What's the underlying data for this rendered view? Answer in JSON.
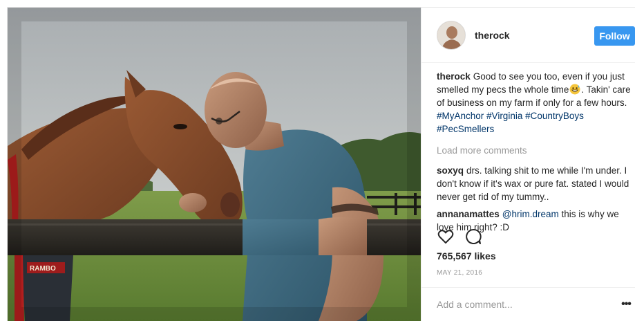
{
  "post": {
    "photo_alt": "Man and horse at fence",
    "blanket_brand": "RAMBO"
  },
  "header": {
    "username": "therock",
    "follow_label": "Follow"
  },
  "caption": {
    "user": "therock",
    "text_before_emoji": "Good to see you too, even if you just smelled my pecs the whole time",
    "emoji": "grinning-face-with-sweat-emoji",
    "text_after_emoji": ". Takin' care of business on my farm if only for a few hours. ",
    "hashtags": [
      "#MyAnchor",
      "#Virginia",
      "#CountryBoys",
      "#PecSmellers"
    ]
  },
  "load_more_label": "Load more comments",
  "comments": [
    {
      "user": "soxyq",
      "text": "drs. talking shit to me while I'm under. I don't know if it's wax or pure fat. stated I would never get rid of my tummy.."
    },
    {
      "user": "annanamattes",
      "mention": "@hrim.dream",
      "text": " this is why we love him right? :D"
    }
  ],
  "actions": {
    "like_icon": "heart-icon",
    "comment_icon": "comment-bubble-icon"
  },
  "likes": "765,567 likes",
  "date": "MAY 21, 2016",
  "add_comment": {
    "placeholder": "Add a comment...",
    "more_icon": "more-options-icon",
    "more_glyph": "•••"
  },
  "colors": {
    "follow_button": "#3897f0",
    "hashtag": "#003569",
    "muted_text": "#999999",
    "primary_text": "#262626"
  }
}
